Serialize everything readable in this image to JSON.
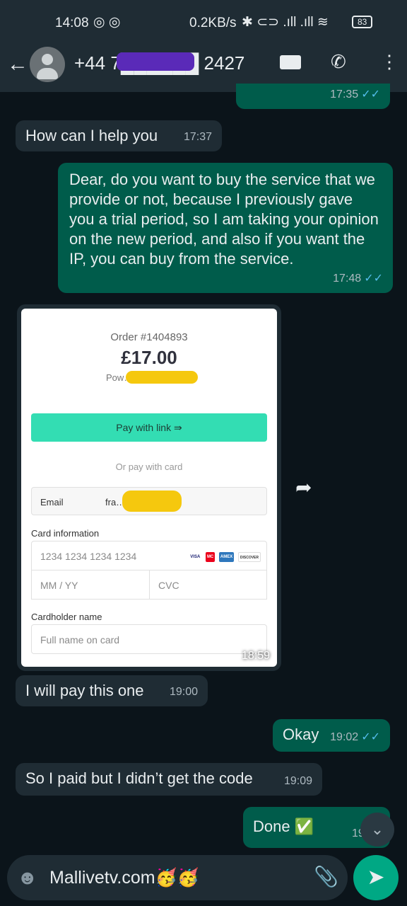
{
  "status": {
    "time": "14:08",
    "speed": "0.2KB/s",
    "battery": "83"
  },
  "header": {
    "contact": "+44 7██████ 2427"
  },
  "messages": [
    {
      "dir": "out",
      "text": "",
      "time": "17:35"
    },
    {
      "dir": "in",
      "text": "How can I help you",
      "time": "17:37"
    },
    {
      "dir": "out",
      "text": "Dear, do you want to buy the service that we provide or not, because I previously gave you a trial period, so I am taking your opinion on the new period, and also if you want the IP, you can buy from the service.",
      "time": "17:48"
    },
    {
      "dir": "in",
      "type": "image",
      "time": "18:59"
    },
    {
      "dir": "in",
      "text": "I will pay this one",
      "time": "19:00"
    },
    {
      "dir": "out",
      "text": "Okay",
      "time": "19:02"
    },
    {
      "dir": "in",
      "text": "So I paid but I didn’t get the code",
      "time": "19:09"
    },
    {
      "dir": "out",
      "text": "Done ✅",
      "time": "19:10"
    }
  ],
  "checkout": {
    "order": "Order #1404893",
    "amount": "£17.00",
    "powered": "Pow…",
    "pay_link": "Pay with link ⇛",
    "or_card": "Or pay with card",
    "email_label": "Email",
    "email_value": "fra…ail.com",
    "card_info": "Card information",
    "card_number": "1234 1234 1234 1234",
    "expiry": "MM / YY",
    "cvc": "CVC",
    "cardholder": "Cardholder name",
    "name_placeholder": "Full name on card",
    "brands": [
      "VISA",
      "MC",
      "AMEX",
      "DISCOVER"
    ]
  },
  "composer": {
    "value": "Mallivetv.com🥳🥳"
  },
  "colors": {
    "outgoing": "#005c4b",
    "incoming": "#1f2c34",
    "accent": "#00a884",
    "link_button": "#33ddb3"
  }
}
